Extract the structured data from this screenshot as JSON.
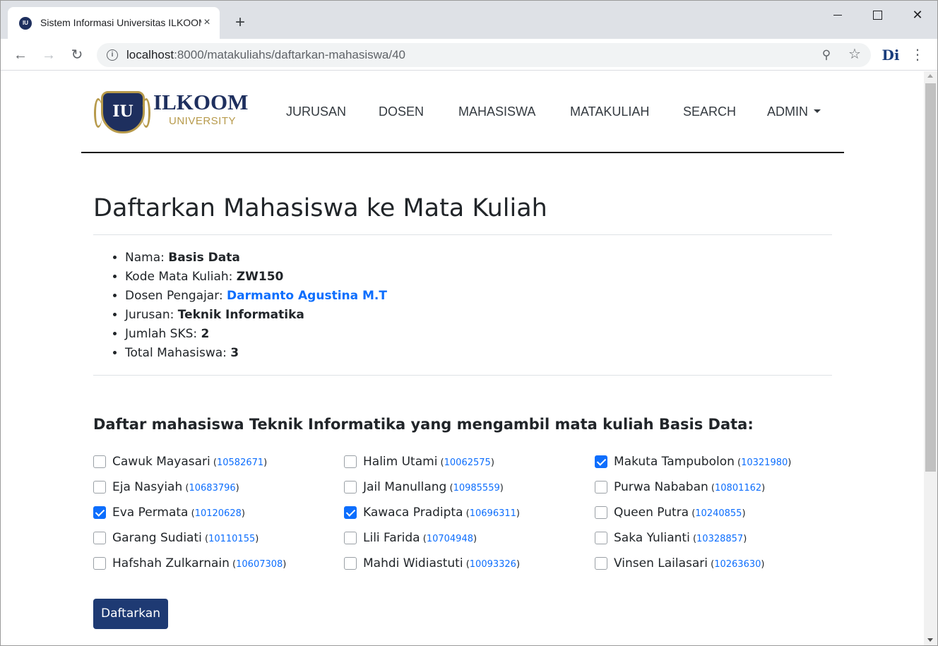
{
  "browser": {
    "tab_title": "Sistem Informasi Universitas ILKOOM",
    "tab_close": "×",
    "new_tab": "+",
    "url_host": "localhost",
    "url_path": ":8000/matakuliahs/daftarkan-mahasiswa/40",
    "window_close": "✕",
    "extension_label": "Di"
  },
  "header": {
    "logo_mark": "IU",
    "logo_name": "ILKOOM",
    "logo_sub": "UNIVERSITY",
    "nav": [
      "JURUSAN",
      "DOSEN",
      "MAHASISWA",
      "MATAKULIAH",
      "SEARCH",
      "ADMIN"
    ]
  },
  "page": {
    "title": "Daftarkan Mahasiswa ke Mata Kuliah",
    "info": [
      {
        "label": "Nama: ",
        "value": "Basis Data"
      },
      {
        "label": "Kode Mata Kuliah: ",
        "value": "ZW150"
      },
      {
        "label": "Dosen Pengajar: ",
        "value": "Darmanto Agustina M.T"
      },
      {
        "label": "Jurusan: ",
        "value": "Teknik Informatika"
      },
      {
        "label": "Jumlah SKS: ",
        "value": "2"
      },
      {
        "label": "Total Mahasiswa: ",
        "value": "3"
      }
    ],
    "section_title": "Daftar mahasiswa Teknik Informatika yang mengambil mata kuliah Basis Data:",
    "students": [
      [
        {
          "name": "Cawuk Mayasari",
          "nim": "10582671",
          "checked": false
        },
        {
          "name": "Eja Nasyiah",
          "nim": "10683796",
          "checked": false
        },
        {
          "name": "Eva Permata",
          "nim": "10120628",
          "checked": true
        },
        {
          "name": "Garang Sudiati",
          "nim": "10110155",
          "checked": false
        },
        {
          "name": "Hafshah Zulkarnain",
          "nim": "10607308",
          "checked": false
        }
      ],
      [
        {
          "name": "Halim Utami",
          "nim": "10062575",
          "checked": false
        },
        {
          "name": "Jail Manullang",
          "nim": "10985559",
          "checked": false
        },
        {
          "name": "Kawaca Pradipta",
          "nim": "10696311",
          "checked": true
        },
        {
          "name": "Lili Farida",
          "nim": "10704948",
          "checked": false
        },
        {
          "name": "Mahdi Widiastuti",
          "nim": "10093326",
          "checked": false
        }
      ],
      [
        {
          "name": "Makuta Tampubolon",
          "nim": "10321980",
          "checked": true
        },
        {
          "name": "Purwa Nababan",
          "nim": "10801162",
          "checked": false
        },
        {
          "name": "Queen Putra",
          "nim": "10240855",
          "checked": false
        },
        {
          "name": "Saka Yulianti",
          "nim": "10328857",
          "checked": false
        },
        {
          "name": "Vinsen Lailasari",
          "nim": "10263630",
          "checked": false
        }
      ]
    ],
    "submit_label": "Daftarkan"
  },
  "colors": {
    "primary_link": "#0d6efd",
    "button_bg": "#1e3a73",
    "logo_navy": "#1e2f5e",
    "logo_gold": "#b79a4b"
  }
}
